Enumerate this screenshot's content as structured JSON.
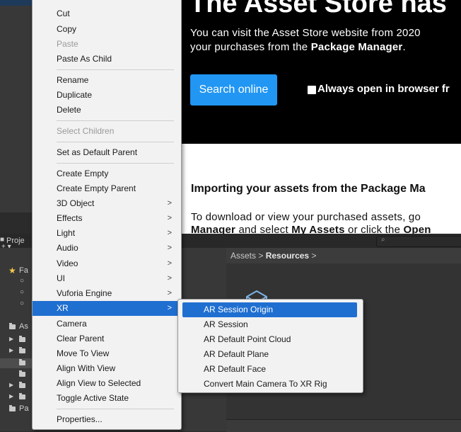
{
  "colors": {
    "accent": "#1f6fd1",
    "button_blue": "#2196f3"
  },
  "project_tab": {
    "label": "Proje"
  },
  "sidebar": {
    "favorites_label": "Fa",
    "assets_label": "As",
    "packages_label": "Pa",
    "add_label": "+ ▾"
  },
  "breadcrumb": {
    "root": "Assets",
    "current": "Resources",
    "sep": ">"
  },
  "search": {
    "icon": "⌕"
  },
  "asset_store_page": {
    "heading": "The Asset Store has",
    "line1": "You can visit the Asset Store website from 2020",
    "line2_prefix": "your purchases from the ",
    "line2_bold": "Package Manager",
    "line2_suffix": ".",
    "search_button": "Search online",
    "checkbox_label": "Always open in browser fr",
    "import_heading": "Importing your assets from the Package Ma",
    "line3": "To download or view your purchased assets, go",
    "line4_bold1": "Manager",
    "line4_mid": " and select ",
    "line4_bold2": "My Assets",
    "line4_mid2": " or click the ",
    "line4_bold3": "Open"
  },
  "context_menu": {
    "items": [
      {
        "label": "Cut"
      },
      {
        "label": "Copy"
      },
      {
        "label": "Paste"
      },
      {
        "label": "Paste As Child"
      },
      {
        "label": "Rename"
      },
      {
        "label": "Duplicate"
      },
      {
        "label": "Delete"
      },
      {
        "label": "Select Children"
      },
      {
        "label": "Set as Default Parent"
      },
      {
        "label": "Create Empty"
      },
      {
        "label": "Create Empty Parent"
      },
      {
        "label": "3D Object"
      },
      {
        "label": "Effects"
      },
      {
        "label": "Light"
      },
      {
        "label": "Audio"
      },
      {
        "label": "Video"
      },
      {
        "label": "UI"
      },
      {
        "label": "Vuforia Engine"
      },
      {
        "label": "XR"
      },
      {
        "label": "Camera"
      },
      {
        "label": "Clear Parent"
      },
      {
        "label": "Move To View"
      },
      {
        "label": "Align With View"
      },
      {
        "label": "Align View to Selected"
      },
      {
        "label": "Toggle Active State"
      },
      {
        "label": "Properties..."
      }
    ],
    "arrow": ">"
  },
  "xr_submenu": {
    "items": [
      {
        "label": "AR Session Origin"
      },
      {
        "label": "AR Session"
      },
      {
        "label": "AR Default Point Cloud"
      },
      {
        "label": "AR Default Plane"
      },
      {
        "label": "AR Default Face"
      },
      {
        "label": "Convert Main Camera To XR Rig"
      }
    ]
  }
}
